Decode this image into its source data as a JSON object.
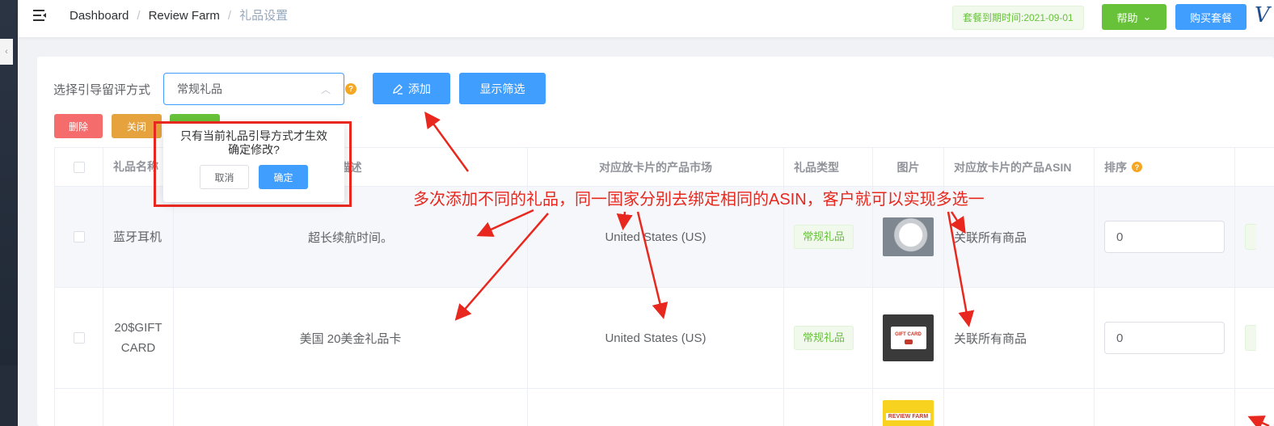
{
  "header": {
    "breadcrumb": [
      {
        "label": "Dashboard"
      },
      {
        "label": "Review Farm"
      },
      {
        "label": "礼品设置"
      }
    ],
    "separator": "/",
    "expire_label": "套餐到期时间:2021-09-01",
    "help_label": "帮助",
    "buy_label": "购买套餐",
    "logo_text": "V"
  },
  "toolbar": {
    "mode_label": "选择引导留评方式",
    "mode_value": "常规礼品",
    "add_label": "添加",
    "filter_label": "显示筛选",
    "delete_label": "删除",
    "close_label": "关闭"
  },
  "popconfirm": {
    "line1": "只有当前礼品引导方式才生效",
    "line2": "确定修改?",
    "cancel_label": "取消",
    "confirm_label": "确定"
  },
  "table": {
    "headers": {
      "name": "礼品名称",
      "desc": "描述",
      "market": "对应放卡片的产品市场",
      "type": "礼品类型",
      "picture": "图片",
      "asin": "对应放卡片的产品ASIN",
      "sort": "排序"
    },
    "rows": [
      {
        "name": "蓝牙耳机",
        "desc": "超长续航时间。",
        "market": "United States (US)",
        "type": "常规礼品",
        "asin": "关联所有商品",
        "sort": "0"
      },
      {
        "name": "20$GIFT CARD",
        "desc": "美国 20美金礼品卡",
        "market": "United States (US)",
        "type": "常规礼品",
        "asin": "关联所有商品",
        "sort": "0"
      }
    ]
  },
  "images": {
    "gift_card_text": "GIFT CARD",
    "review_farm_text": "REVIEW FARM"
  },
  "annotation": {
    "text": "多次添加不同的礼品，同一国家分别去绑定相同的ASIN，客户就可以实现多选一"
  },
  "colors": {
    "primary": "#409eff",
    "success": "#67c23a",
    "danger": "#f56c6c",
    "warning": "#e6a23c",
    "annotation_red": "#e8281e"
  }
}
